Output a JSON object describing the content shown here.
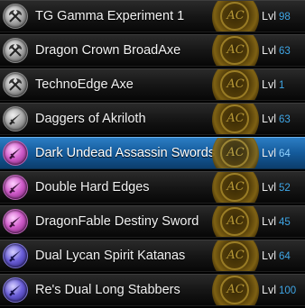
{
  "items": [
    {
      "name": "TG Gamma Experiment 1",
      "lvl_label": "Lvl",
      "lvl": "98",
      "icon": "axe-icon",
      "icon_color": "#a9a9a9",
      "badge": "AC",
      "selected": false
    },
    {
      "name": "Dragon Crown BroadAxe",
      "lvl_label": "Lvl",
      "lvl": "63",
      "icon": "axe-icon",
      "icon_color": "#a9a9a9",
      "badge": "AC",
      "selected": false
    },
    {
      "name": "TechnoEdge Axe",
      "lvl_label": "Lvl",
      "lvl": "1",
      "icon": "axe-icon",
      "icon_color": "#a9a9a9",
      "badge": "AC",
      "selected": false
    },
    {
      "name": "Daggers of Akriloth",
      "lvl_label": "Lvl",
      "lvl": "63",
      "icon": "dagger-icon",
      "icon_color": "#a9a9a9",
      "badge": "AC",
      "selected": false
    },
    {
      "name": "Dark Undead Assassin Swords",
      "lvl_label": "Lvl",
      "lvl": "64",
      "icon": "dual-sword-icon",
      "icon_color": "#d15ccb",
      "badge": "AC",
      "selected": true
    },
    {
      "name": "Double Hard Edges",
      "lvl_label": "Lvl",
      "lvl": "52",
      "icon": "dual-sword-icon",
      "icon_color": "#d15ccb",
      "badge": "AC",
      "selected": false
    },
    {
      "name": "DragonFable Destiny Sword",
      "lvl_label": "Lvl",
      "lvl": "45",
      "icon": "dual-sword-icon",
      "icon_color": "#d15ccb",
      "badge": "AC",
      "selected": false
    },
    {
      "name": "Dual Lycan Spirit Katanas",
      "lvl_label": "Lvl",
      "lvl": "64",
      "icon": "dual-sword-icon",
      "icon_color": "#6a5ed8",
      "badge": "AC",
      "selected": false
    },
    {
      "name": "Re's Dual Long Stabbers",
      "lvl_label": "Lvl",
      "lvl": "100",
      "icon": "dual-sword-icon",
      "icon_color": "#6a5ed8",
      "badge": "AC",
      "selected": false
    }
  ]
}
